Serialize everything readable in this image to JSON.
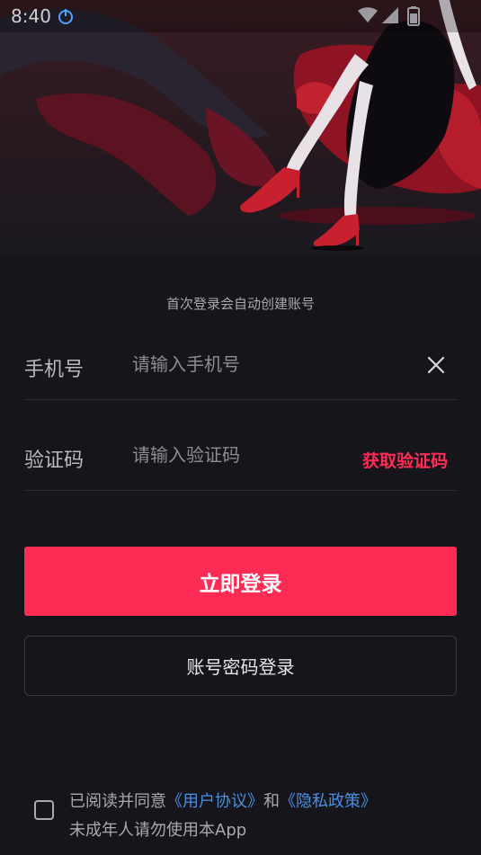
{
  "status_bar": {
    "time": "8:40"
  },
  "icons": {
    "clear": "close-icon",
    "checkbox": "checkbox-unchecked",
    "wifi": "wifi-icon",
    "signal": "signal-icon",
    "battery": "battery-icon"
  },
  "hint": "首次登录会自动创建账号",
  "phone_row": {
    "label": "手机号",
    "placeholder": "请输入手机号"
  },
  "code_row": {
    "label": "验证码",
    "placeholder": "请输入验证码",
    "get_code": "获取验证码"
  },
  "login_button": "立即登录",
  "password_login_button": "账号密码登录",
  "agreement": {
    "prefix": "已阅读并同意",
    "user_agreement": "《用户协议》",
    "and": "和",
    "privacy_policy": "《隐私政策》",
    "minor_notice": "未成年人请勿使用本App"
  },
  "colors": {
    "accent": "#fe2c55",
    "link": "#4b8fe0",
    "background": "#16151c"
  }
}
